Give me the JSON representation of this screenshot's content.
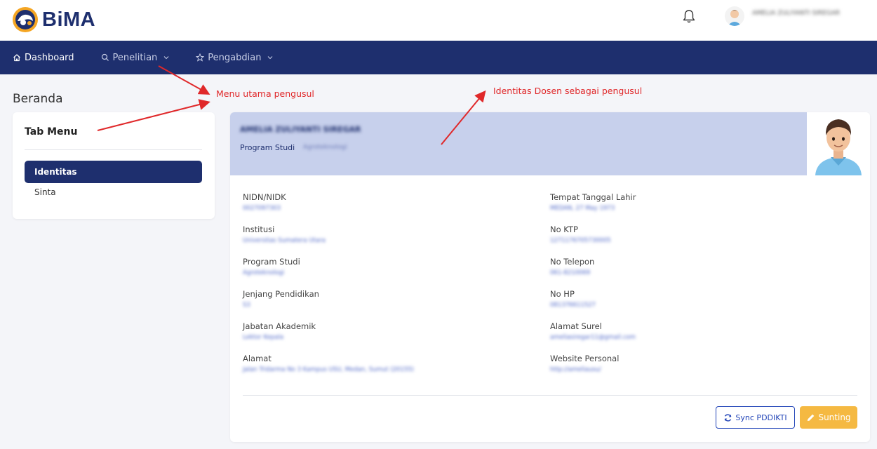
{
  "header": {
    "logo_text": "BiMA",
    "user_name": "AMELIA ZULIYANTI SIREGAR"
  },
  "nav": {
    "items": [
      {
        "label": "Dashboard",
        "icon": "home-icon"
      },
      {
        "label": "Penelitian",
        "icon": "search-icon",
        "has_dropdown": true
      },
      {
        "label": "Pengabdian",
        "icon": "star-icon",
        "has_dropdown": true
      }
    ]
  },
  "page": {
    "title": "Beranda"
  },
  "tab_menu": {
    "title": "Tab Menu",
    "items": [
      {
        "label": "Identitas",
        "active": true
      },
      {
        "label": "Sinta",
        "active": false
      }
    ]
  },
  "identity": {
    "name": "AMELIA ZULIYANTI SIREGAR",
    "prodi_label": "Program Studi",
    "prodi_value": "Agroteknologi",
    "left_fields": [
      {
        "label": "NIDN/NIDK",
        "value": "0027097303"
      },
      {
        "label": "Institusi",
        "value": "Universitas Sumatera Utara"
      },
      {
        "label": "Program Studi",
        "value": "Agroteknologi"
      },
      {
        "label": "Jenjang Pendidikan",
        "value": "S3"
      },
      {
        "label": "Jabatan Akademik",
        "value": "Lektor Kepala"
      },
      {
        "label": "Alamat",
        "value": "Jalan Tridarma No 3 Kampus USU, Medan, Sumut (20155)"
      }
    ],
    "right_fields": [
      {
        "label": "Tempat Tanggal Lahir",
        "value": "MEDAN, 27 May 1973"
      },
      {
        "label": "No KTP",
        "value": "1271176705730005"
      },
      {
        "label": "No Telepon",
        "value": "061-8210069"
      },
      {
        "label": "No HP",
        "value": "081376611527"
      },
      {
        "label": "Alamat Surel",
        "value": "ameliasiregar11@gmail.com"
      },
      {
        "label": "Website Personal",
        "value": "http://ameliausu/"
      }
    ]
  },
  "actions": {
    "sync_label": "Sync PDDIKTI",
    "edit_label": "Sunting"
  },
  "annotations": {
    "menu_note": "Menu utama pengusul",
    "identity_note": "Identitas Dosen sebagai pengusul"
  },
  "colors": {
    "primary": "#1e2f6e",
    "banner": "#c7d0ec",
    "accent_button": "#f5b942",
    "annotation": "#e0282a"
  }
}
